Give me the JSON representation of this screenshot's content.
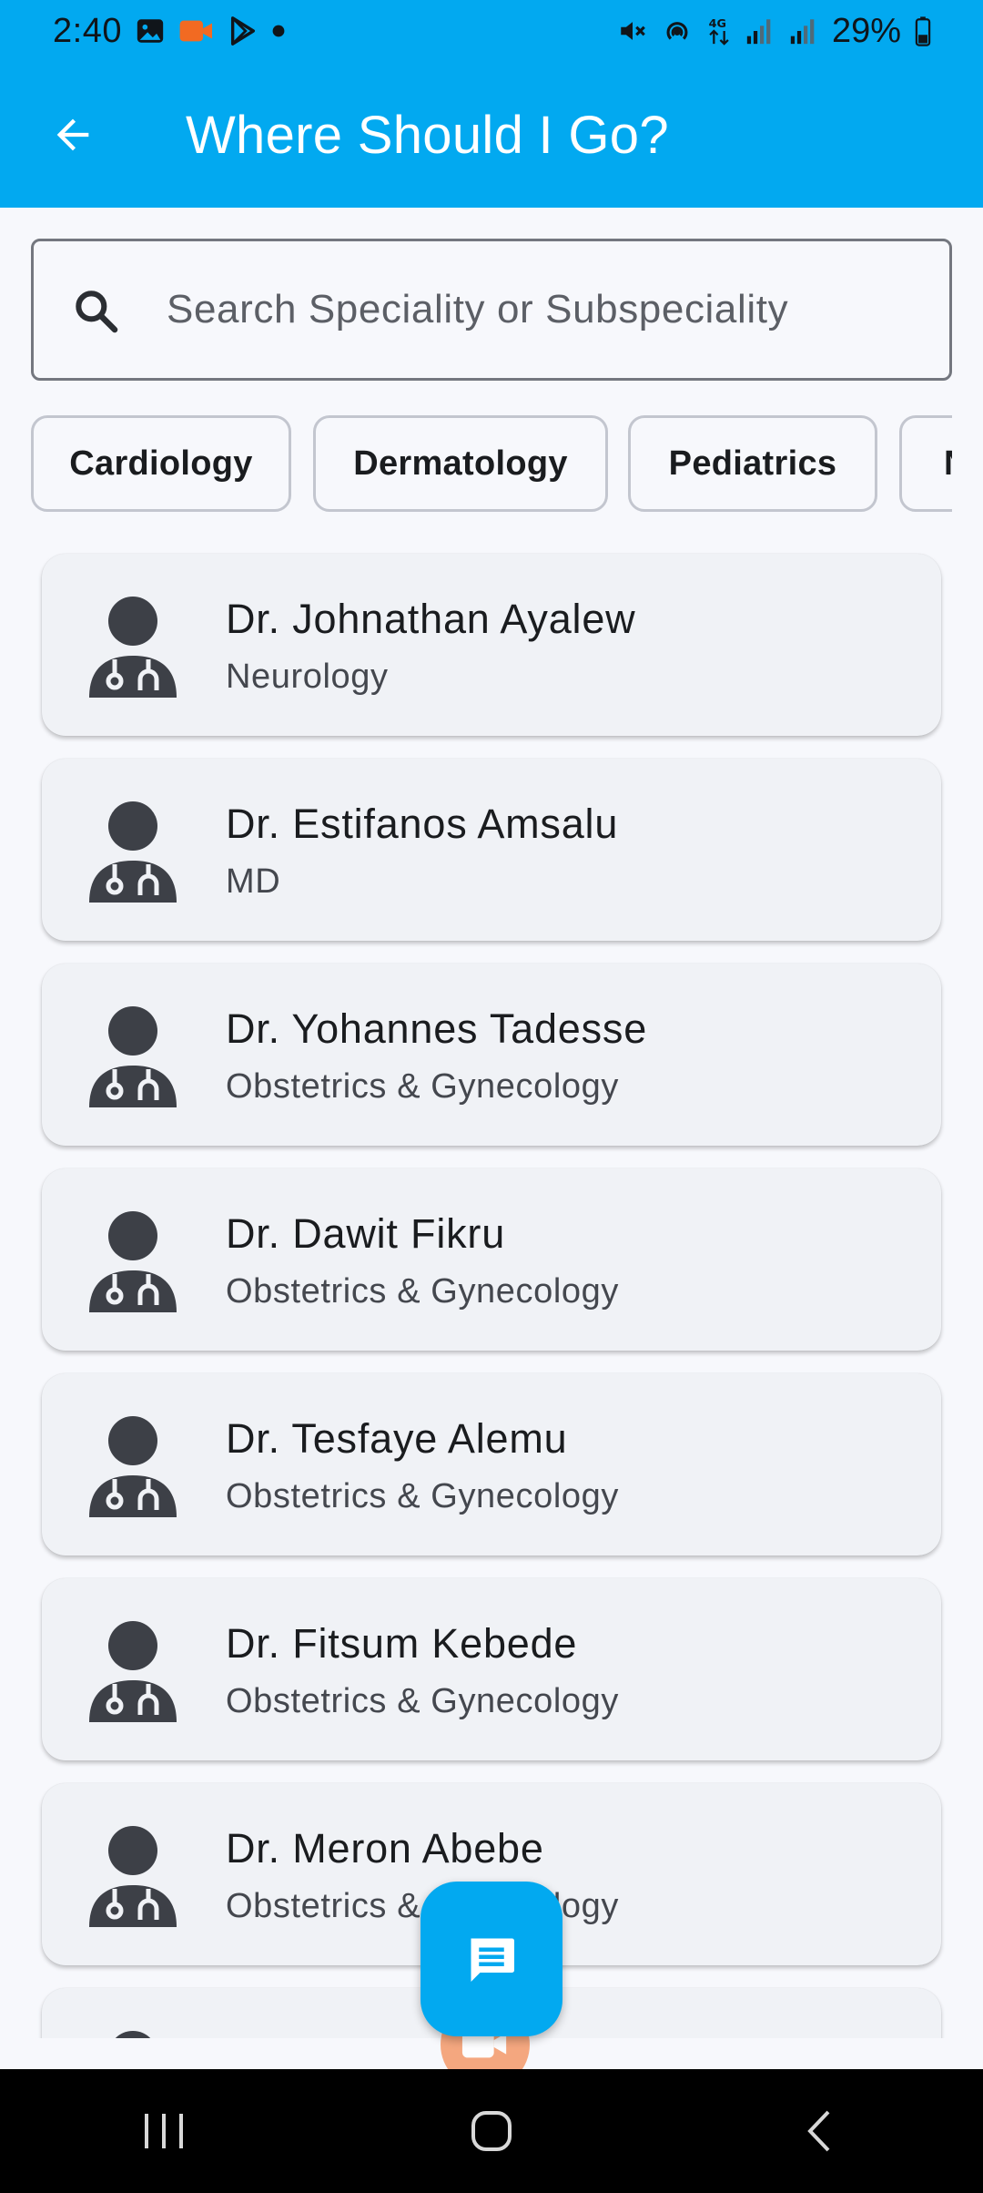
{
  "status_bar": {
    "time": "2:40",
    "battery": "29%"
  },
  "app_bar": {
    "title": "Where Should I Go?"
  },
  "search": {
    "placeholder": "Search Speciality or Subspeciality"
  },
  "chips": [
    {
      "label": "Cardiology"
    },
    {
      "label": "Dermatology"
    },
    {
      "label": "Pediatrics"
    },
    {
      "label": "N"
    }
  ],
  "doctors": [
    {
      "name": "Dr. Johnathan Ayalew",
      "specialty": "Neurology"
    },
    {
      "name": "Dr. Estifanos Amsalu",
      "specialty": "MD"
    },
    {
      "name": "Dr. Yohannes Tadesse",
      "specialty": "Obstetrics & Gynecology"
    },
    {
      "name": "Dr. Dawit Fikru",
      "specialty": "Obstetrics & Gynecology"
    },
    {
      "name": "Dr. Tesfaye Alemu",
      "specialty": "Obstetrics & Gynecology"
    },
    {
      "name": "Dr. Fitsum Kebede",
      "specialty": "Obstetrics & Gynecology"
    },
    {
      "name": "Dr. Meron Abebe",
      "specialty": "Obstetrics & Gynecology"
    }
  ],
  "colors": {
    "primary": "#02a9f0",
    "card_bg": "#f0f2f6",
    "icon_dark": "#3d4047",
    "video_fab": "#f49a6a"
  },
  "icons": {
    "back": "arrow-left-icon",
    "search": "search-icon",
    "doctor": "doctor-icon",
    "chat": "chat-icon",
    "video": "video-call-icon"
  }
}
